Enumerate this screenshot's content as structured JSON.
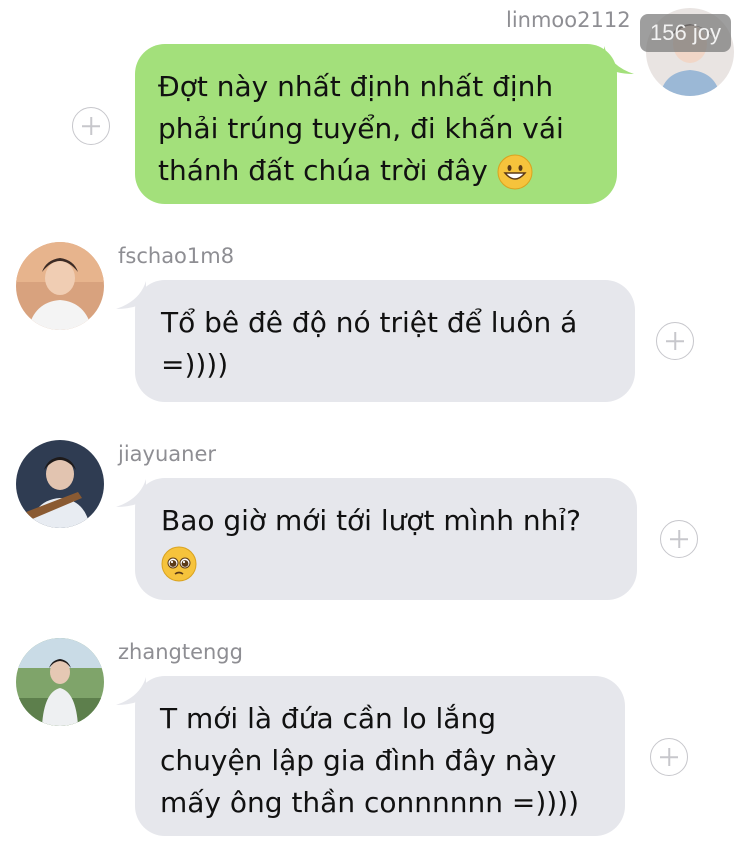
{
  "messages": [
    {
      "sender": "linmoo2112",
      "direction": "outgoing",
      "lines": [
        "Đợt này nhất định nhất định",
        "phải trúng tuyển, đi khấn vái",
        "thánh đất chúa trời đây"
      ],
      "emoji": "grinning-face"
    },
    {
      "sender": "fschao1m8",
      "direction": "incoming",
      "lines": [
        "Tổ bê đê độ nó triệt để luôn á",
        "=))))"
      ]
    },
    {
      "sender": "jiayuaner",
      "direction": "incoming",
      "lines": [
        "Bao giờ mới tới lượt mình nhỉ?"
      ],
      "emoji": "pleading-face"
    },
    {
      "sender": "zhangtengg",
      "direction": "incoming",
      "lines": [
        "T mới là đứa cần lo lắng",
        "chuyện lập gia đình đây này",
        "mấy ông thần connnnnn =))))"
      ]
    }
  ],
  "watermark": "156 joy",
  "colors": {
    "outgoing_bubble": "#a3e07b",
    "incoming_bubble": "#e6e7ec",
    "username": "#8e8e93"
  },
  "icons": [
    "plus-circle-icon"
  ]
}
